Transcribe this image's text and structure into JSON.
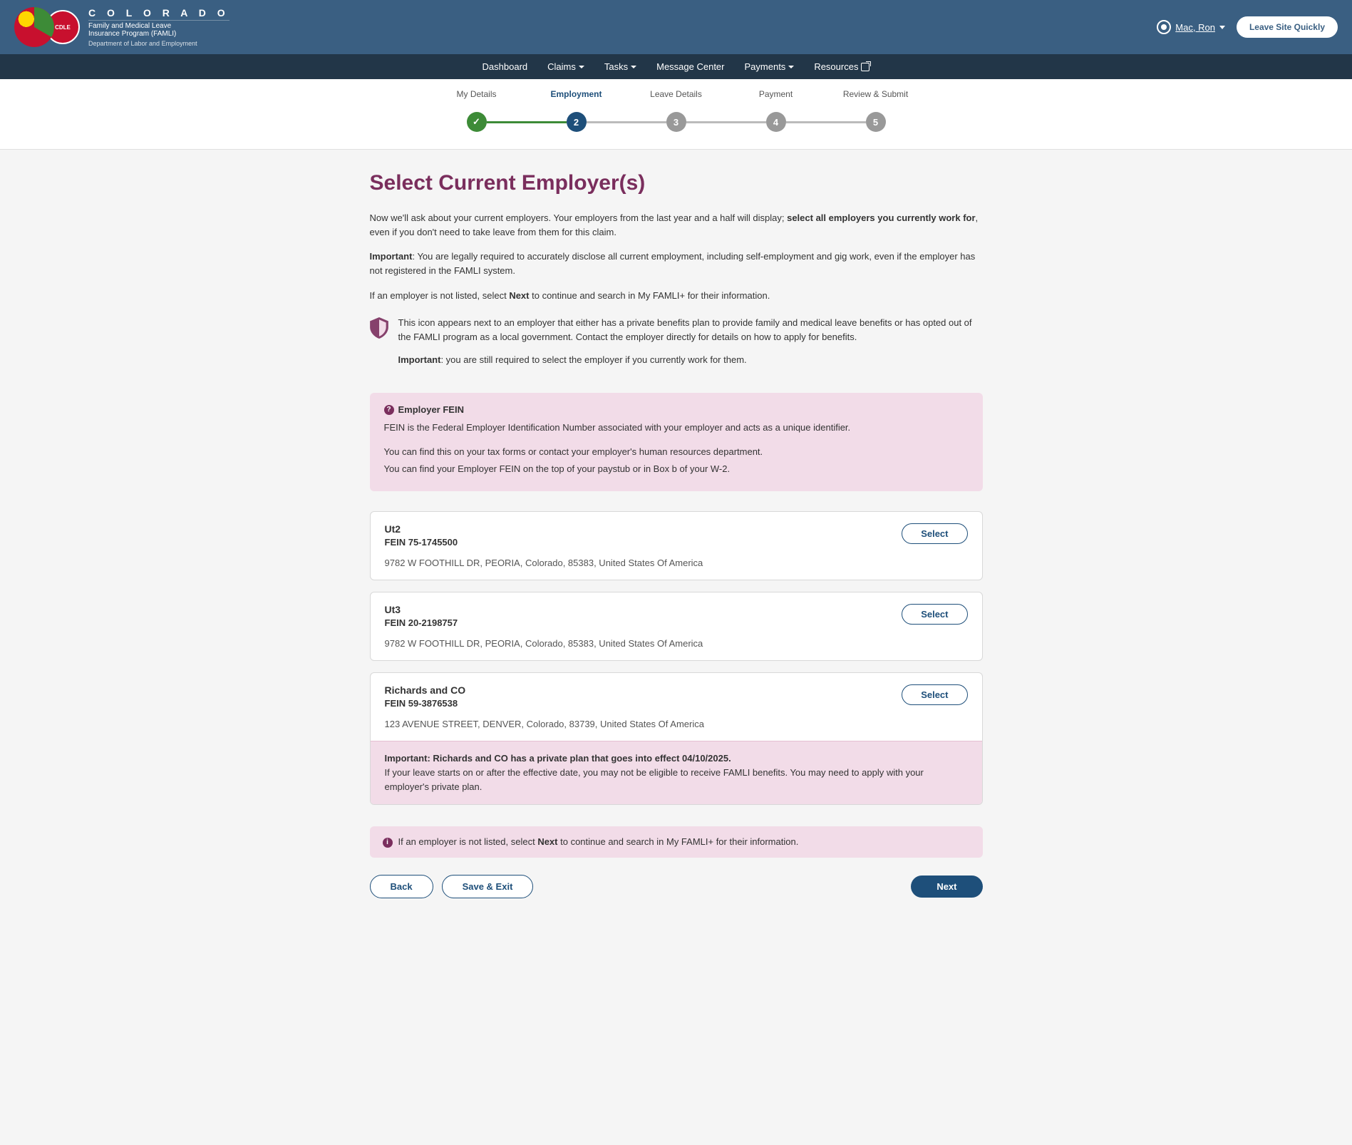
{
  "header": {
    "brand_title": "C O L O R A D O",
    "brand_sub1": "Family and Medical Leave\nInsurance Program (FAMLI)",
    "brand_sub2": "Department of Labor and Employment",
    "user_name": "Mac, Ron",
    "leave_btn": "Leave Site Quickly"
  },
  "nav": {
    "dashboard": "Dashboard",
    "claims": "Claims",
    "tasks": "Tasks",
    "message_center": "Message Center",
    "payments": "Payments",
    "resources": "Resources"
  },
  "steps": {
    "labels": [
      "My Details",
      "Employment",
      "Leave Details",
      "Payment",
      "Review & Submit"
    ],
    "nums": [
      "",
      "2",
      "3",
      "4",
      "5"
    ]
  },
  "page": {
    "title": "Select Current Employer(s)",
    "p1a": "Now we'll ask about your current employers. Your employers from the last year and a half will display; ",
    "p1b": "select all employers you currently work for",
    "p1c": ", even if you don't need to take leave from them for this claim.",
    "p2a": "Important",
    "p2b": ": You are legally required to accurately disclose all current employment, including self-employment and gig work, even if the employer has not registered in the FAMLI system.",
    "p3a": "If an employer is not listed, select ",
    "p3b": "Next",
    "p3c": " to continue and search in My FAMLI+ for their information.",
    "shield1": "This icon appears next to an employer that either has a private benefits plan to provide family and medical leave benefits or has opted out of the FAMLI program as a local government. Contact the employer directly for details on how to apply for benefits.",
    "shield2a": "Important",
    "shield2b": ": you are still required to select the employer if you currently work for them."
  },
  "fein": {
    "heading": "Employer FEIN",
    "p1": "FEIN is the Federal Employer Identification Number associated with your employer and acts as a unique identifier.",
    "p2": "You can find this on your tax forms or contact your employer's human resources department.",
    "p3": "You can find your Employer FEIN on the top of your paystub or in Box b of your W-2."
  },
  "employers": [
    {
      "name": "Ut2",
      "fein": "FEIN 75-1745500",
      "addr": "9782 W FOOTHILL DR, PEORIA, Colorado, 85383, United States Of America",
      "select": "Select"
    },
    {
      "name": "Ut3",
      "fein": "FEIN 20-2198757",
      "addr": "9782 W FOOTHILL DR, PEORIA, Colorado, 85383, United States Of America",
      "select": "Select"
    },
    {
      "name": "Richards and CO",
      "fein": "FEIN 59-3876538",
      "addr": "123 AVENUE STREET, DENVER, Colorado, 83739, United States Of America",
      "select": "Select",
      "warn_a": "Important: Richards and CO has a private plan that goes into effect 04/10/2025.",
      "warn_b": "If your leave starts on or after the effective date, you may not be eligible to receive FAMLI benefits. You may need to apply with your employer's private plan."
    }
  ],
  "notice": {
    "a": "If an employer is not listed, select ",
    "b": "Next",
    "c": " to continue and search in My FAMLI+ for their information."
  },
  "actions": {
    "back": "Back",
    "save": "Save & Exit",
    "next": "Next"
  }
}
